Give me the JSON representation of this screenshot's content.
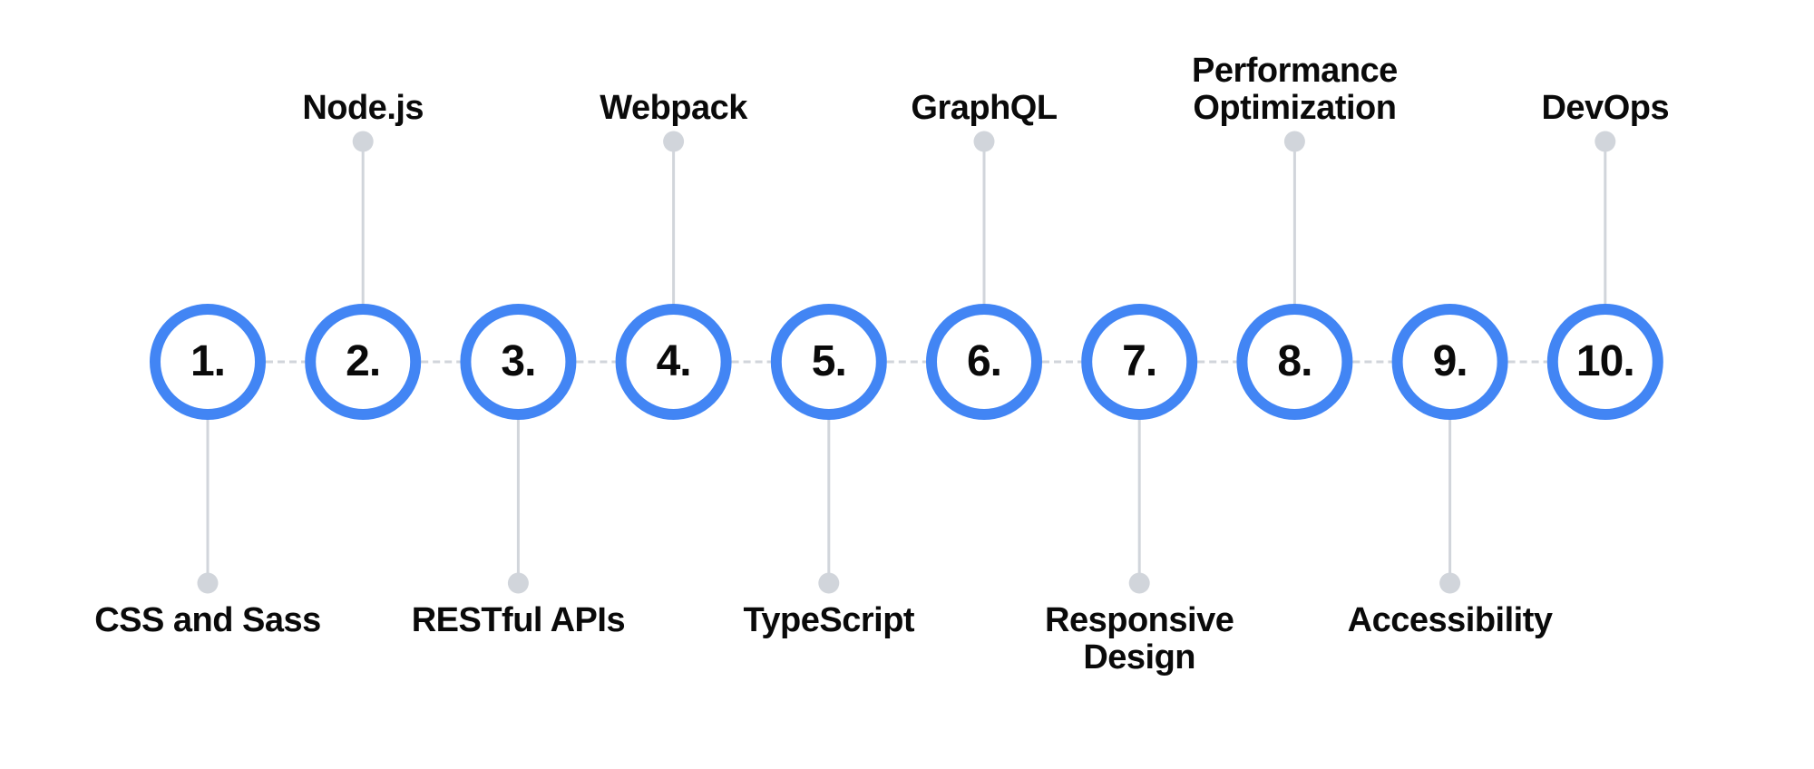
{
  "diagram": {
    "type": "numbered-timeline",
    "colors": {
      "circle_stroke": "#4285F4",
      "circle_fill": "#ffffff",
      "connector": "#D1D5DB",
      "dashed_line": "#D1D5DB",
      "text": "#0A0A0A"
    },
    "steps": [
      {
        "number": "1.",
        "label": "CSS and Sass",
        "position": "bottom"
      },
      {
        "number": "2.",
        "label": "Node.js",
        "position": "top"
      },
      {
        "number": "3.",
        "label": "RESTful APIs",
        "position": "bottom"
      },
      {
        "number": "4.",
        "label": "Webpack",
        "position": "top"
      },
      {
        "number": "5.",
        "label": "TypeScript",
        "position": "bottom"
      },
      {
        "number": "6.",
        "label": "GraphQL",
        "position": "top"
      },
      {
        "number": "7.",
        "label": "Responsive\nDesign",
        "position": "bottom"
      },
      {
        "number": "8.",
        "label": "Performance\nOptimization",
        "position": "top"
      },
      {
        "number": "9.",
        "label": "Accessibility",
        "position": "bottom"
      },
      {
        "number": "10.",
        "label": "DevOps",
        "position": "top"
      }
    ]
  }
}
